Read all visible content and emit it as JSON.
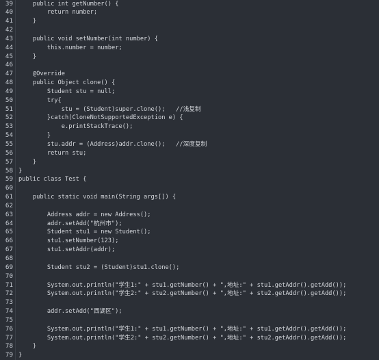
{
  "editor": {
    "lines": [
      {
        "num": "39",
        "text": "    public int getNumber() {"
      },
      {
        "num": "40",
        "text": "        return number;"
      },
      {
        "num": "41",
        "text": "    }"
      },
      {
        "num": "42",
        "text": ""
      },
      {
        "num": "43",
        "text": "    public void setNumber(int number) {"
      },
      {
        "num": "44",
        "text": "        this.number = number;"
      },
      {
        "num": "45",
        "text": "    }"
      },
      {
        "num": "46",
        "text": ""
      },
      {
        "num": "47",
        "text": "    @Override"
      },
      {
        "num": "48",
        "text": "    public Object clone() {"
      },
      {
        "num": "49",
        "text": "        Student stu = null;"
      },
      {
        "num": "50",
        "text": "        try{"
      },
      {
        "num": "51",
        "text": "            stu = (Student)super.clone();   //浅复制"
      },
      {
        "num": "52",
        "text": "        }catch(CloneNotSupportedException e) {"
      },
      {
        "num": "53",
        "text": "            e.printStackTrace();"
      },
      {
        "num": "54",
        "text": "        }"
      },
      {
        "num": "55",
        "text": "        stu.addr = (Address)addr.clone();   //深度复制"
      },
      {
        "num": "56",
        "text": "        return stu;"
      },
      {
        "num": "57",
        "text": "    }"
      },
      {
        "num": "58",
        "text": "}"
      },
      {
        "num": "59",
        "text": "public class Test {"
      },
      {
        "num": "60",
        "text": ""
      },
      {
        "num": "61",
        "text": "    public static void main(String args[]) {"
      },
      {
        "num": "62",
        "text": ""
      },
      {
        "num": "63",
        "text": "        Address addr = new Address();"
      },
      {
        "num": "64",
        "text": "        addr.setAdd(\"杭州市\");"
      },
      {
        "num": "65",
        "text": "        Student stu1 = new Student();"
      },
      {
        "num": "66",
        "text": "        stu1.setNumber(123);"
      },
      {
        "num": "67",
        "text": "        stu1.setAddr(addr);"
      },
      {
        "num": "68",
        "text": ""
      },
      {
        "num": "69",
        "text": "        Student stu2 = (Student)stu1.clone();"
      },
      {
        "num": "70",
        "text": ""
      },
      {
        "num": "71",
        "text": "        System.out.println(\"学生1:\" + stu1.getNumber() + \",地址:\" + stu1.getAddr().getAdd());"
      },
      {
        "num": "72",
        "text": "        System.out.println(\"学生2:\" + stu2.getNumber() + \",地址:\" + stu2.getAddr().getAdd());"
      },
      {
        "num": "73",
        "text": ""
      },
      {
        "num": "74",
        "text": "        addr.setAdd(\"西湖区\");"
      },
      {
        "num": "75",
        "text": ""
      },
      {
        "num": "76",
        "text": "        System.out.println(\"学生1:\" + stu1.getNumber() + \",地址:\" + stu1.getAddr().getAdd());"
      },
      {
        "num": "77",
        "text": "        System.out.println(\"学生2:\" + stu2.getNumber() + \",地址:\" + stu2.getAddr().getAdd());"
      },
      {
        "num": "78",
        "text": "    }"
      },
      {
        "num": "79",
        "text": "}"
      }
    ],
    "colors": {
      "background": "#2b2f36",
      "text": "#d4d7dc",
      "line_number": "#c9ced6"
    }
  }
}
